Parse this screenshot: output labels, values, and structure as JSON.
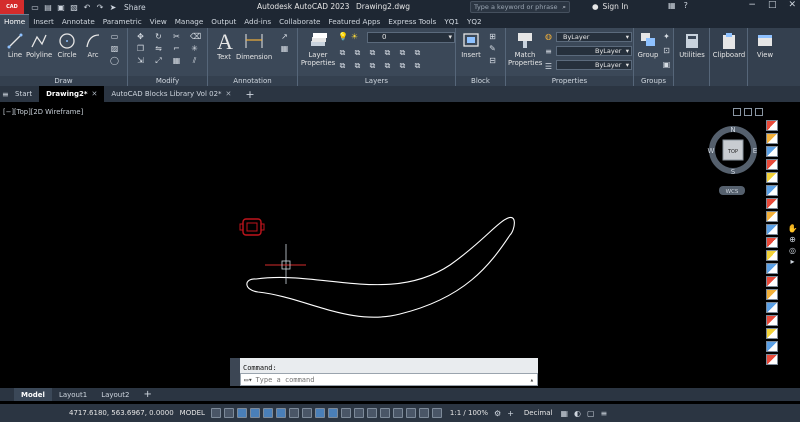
{
  "titlebar": {
    "app_badge": "CAD",
    "share_label": "Share",
    "app_title": "Autodesk AutoCAD 2023",
    "file_name": "Drawing2.dwg",
    "search_placeholder": "Type a keyword or phrase",
    "signin_label": "Sign In"
  },
  "ribbon_tabs": [
    "Home",
    "Insert",
    "Annotate",
    "Parametric",
    "View",
    "Manage",
    "Output",
    "Add-ins",
    "Collaborate",
    "Featured Apps",
    "Express Tools",
    "YQ1",
    "YQ2"
  ],
  "ribbon": {
    "draw": {
      "label": "Draw",
      "tools": [
        "Line",
        "Polyline",
        "Circle",
        "Arc"
      ]
    },
    "modify": {
      "label": "Modify"
    },
    "annotation": {
      "label": "Annotation",
      "tools": [
        "Text",
        "Dimension"
      ]
    },
    "layers": {
      "label": "Layers",
      "tool_line1": "Layer",
      "tool_line2": "Properties",
      "current_layer": "0"
    },
    "block": {
      "label": "Block",
      "tool": "Insert"
    },
    "properties": {
      "label": "Properties",
      "tool_line1": "Match",
      "tool_line2": "Properties",
      "color": "ByLayer",
      "linetype": "ByLayer",
      "lineweight": "ByLayer"
    },
    "groups": {
      "label": "Groups",
      "tool": "Group"
    },
    "utilities": "Utilities",
    "clipboard": "Clipboard",
    "view": "View"
  },
  "file_tabs": [
    {
      "label": "Start"
    },
    {
      "label": "Drawing2*"
    },
    {
      "label": "AutoCAD Blocks Library Vol 02*"
    }
  ],
  "viewport": {
    "label": "[−][Top][2D Wireframe]",
    "viewcube": {
      "n": "N",
      "s": "S",
      "e": "E",
      "w": "W",
      "face": "TOP",
      "wcs": "WCS"
    }
  },
  "command": {
    "history": "Command:",
    "placeholder": "Type a command"
  },
  "layout_tabs": [
    "Model",
    "Layout1",
    "Layout2"
  ],
  "status": {
    "coordinates": "4717.6180, 563.6967, 0.0000",
    "space": "MODEL",
    "scale": "1:1 / 100%",
    "units": "Decimal"
  },
  "colors": {
    "accent": "#3b4858",
    "drawing_stroke": "#ffffff",
    "selected_block": "#c0141c",
    "crosshair": "#d42c2c"
  }
}
